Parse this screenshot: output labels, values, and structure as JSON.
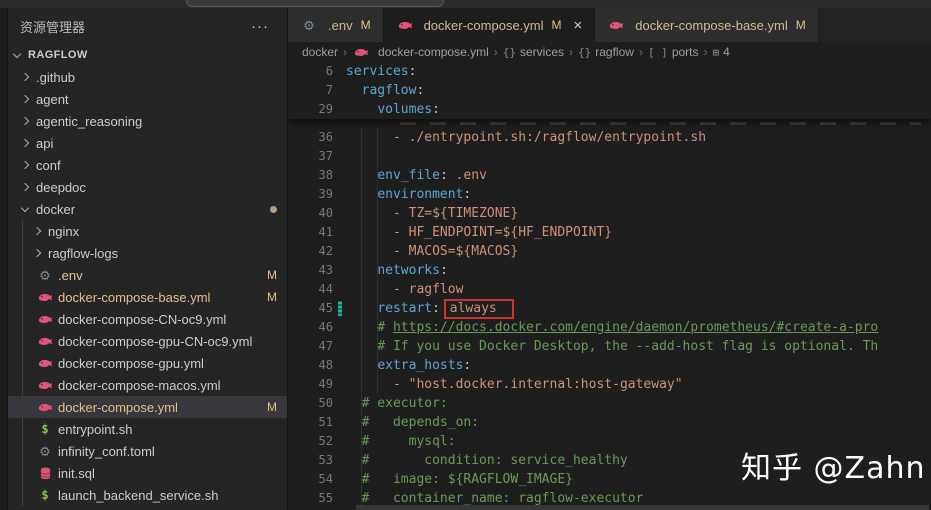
{
  "titlebar": {
    "command_center": ""
  },
  "sidebar": {
    "header": "资源管理器",
    "more": "···",
    "section": "RAGFLOW",
    "items": [
      {
        "label": ".github",
        "kind": "folder",
        "depth": 1
      },
      {
        "label": "agent",
        "kind": "folder",
        "depth": 1
      },
      {
        "label": "agentic_reasoning",
        "kind": "folder",
        "depth": 1
      },
      {
        "label": "api",
        "kind": "folder",
        "depth": 1
      },
      {
        "label": "conf",
        "kind": "folder",
        "depth": 1
      },
      {
        "label": "deepdoc",
        "kind": "folder",
        "depth": 1
      },
      {
        "label": "docker",
        "kind": "folder",
        "depth": 1,
        "expanded": true,
        "dot": true
      },
      {
        "label": "nginx",
        "kind": "folder",
        "depth": 2
      },
      {
        "label": "ragflow-logs",
        "kind": "folder",
        "depth": 2
      },
      {
        "label": ".env",
        "kind": "file",
        "icon": "gear",
        "depth": 2,
        "badge": "M",
        "modified": true
      },
      {
        "label": "docker-compose-base.yml",
        "kind": "file",
        "icon": "docker",
        "depth": 2,
        "badge": "M",
        "modified": true
      },
      {
        "label": "docker-compose-CN-oc9.yml",
        "kind": "file",
        "icon": "docker",
        "depth": 2
      },
      {
        "label": "docker-compose-gpu-CN-oc9.yml",
        "kind": "file",
        "icon": "docker",
        "depth": 2
      },
      {
        "label": "docker-compose-gpu.yml",
        "kind": "file",
        "icon": "docker",
        "depth": 2
      },
      {
        "label": "docker-compose-macos.yml",
        "kind": "file",
        "icon": "docker",
        "depth": 2
      },
      {
        "label": "docker-compose.yml",
        "kind": "file",
        "icon": "docker",
        "depth": 2,
        "badge": "M",
        "modified": true,
        "selected": true
      },
      {
        "label": "entrypoint.sh",
        "kind": "file",
        "icon": "shell",
        "depth": 2
      },
      {
        "label": "infinity_conf.toml",
        "kind": "file",
        "icon": "gear",
        "depth": 2
      },
      {
        "label": "init.sql",
        "kind": "file",
        "icon": "database",
        "depth": 2
      },
      {
        "label": "launch_backend_service.sh",
        "kind": "file",
        "icon": "shell",
        "depth": 2
      }
    ]
  },
  "tabs": [
    {
      "label": ".env",
      "icon": "gear",
      "badge": "M",
      "active": false
    },
    {
      "label": "docker-compose.yml",
      "icon": "docker",
      "badge": "M",
      "active": true,
      "close": "×"
    },
    {
      "label": "docker-compose-base.yml",
      "icon": "docker",
      "badge": "M",
      "active": false
    }
  ],
  "breadcrumb": [
    {
      "label": "docker"
    },
    {
      "label": "docker-compose.yml",
      "icon": "docker"
    },
    {
      "label": "services",
      "icon": "object"
    },
    {
      "label": "ragflow",
      "icon": "object"
    },
    {
      "label": "ports",
      "icon": "array"
    },
    {
      "label": "4",
      "icon": "value"
    }
  ],
  "editor": {
    "watermark": "知乎 @Zahn",
    "sticky_lines": [
      {
        "num": "6",
        "tokens": [
          {
            "t": "services",
            "c": "key"
          },
          {
            "t": ":",
            "c": "punc"
          }
        ]
      },
      {
        "num": "7",
        "tokens": [
          {
            "t": "  "
          },
          {
            "t": "ragflow",
            "c": "key"
          },
          {
            "t": ":",
            "c": "punc"
          }
        ]
      },
      {
        "num": "29",
        "tokens": [
          {
            "t": "    "
          },
          {
            "t": "volumes",
            "c": "key"
          },
          {
            "t": ":",
            "c": "punc"
          }
        ]
      }
    ],
    "lines": [
      {
        "num": "36",
        "tokens": [
          {
            "t": "      "
          },
          {
            "t": "- ",
            "c": "dash"
          },
          {
            "t": "./entrypoint.sh:/ragflow/entrypoint.sh",
            "c": "val"
          }
        ]
      },
      {
        "num": "37",
        "tokens": []
      },
      {
        "num": "38",
        "tokens": [
          {
            "t": "    "
          },
          {
            "t": "env_file",
            "c": "key"
          },
          {
            "t": ": ",
            "c": "punc"
          },
          {
            "t": ".env",
            "c": "val"
          }
        ]
      },
      {
        "num": "39",
        "tokens": [
          {
            "t": "    "
          },
          {
            "t": "environment",
            "c": "key"
          },
          {
            "t": ":",
            "c": "punc"
          }
        ]
      },
      {
        "num": "40",
        "tokens": [
          {
            "t": "      "
          },
          {
            "t": "- ",
            "c": "dash"
          },
          {
            "t": "TZ=${TIMEZONE}",
            "c": "val"
          }
        ]
      },
      {
        "num": "41",
        "tokens": [
          {
            "t": "      "
          },
          {
            "t": "- ",
            "c": "dash"
          },
          {
            "t": "HF_ENDPOINT=${HF_ENDPOINT}",
            "c": "val"
          }
        ]
      },
      {
        "num": "42",
        "tokens": [
          {
            "t": "      "
          },
          {
            "t": "- ",
            "c": "dash"
          },
          {
            "t": "MACOS=${MACOS}",
            "c": "val"
          }
        ]
      },
      {
        "num": "43",
        "tokens": [
          {
            "t": "    "
          },
          {
            "t": "networks",
            "c": "key"
          },
          {
            "t": ":",
            "c": "punc"
          }
        ]
      },
      {
        "num": "44",
        "tokens": [
          {
            "t": "      "
          },
          {
            "t": "- ",
            "c": "dash"
          },
          {
            "t": "ragflow",
            "c": "val"
          }
        ]
      },
      {
        "num": "45",
        "marker": true,
        "tokens": [
          {
            "t": "    "
          },
          {
            "t": "restart",
            "c": "key"
          },
          {
            "t": ": ",
            "c": "punc"
          },
          {
            "t": "always",
            "c": "val boxed"
          }
        ]
      },
      {
        "num": "46",
        "tokens": [
          {
            "t": "    "
          },
          {
            "t": "# ",
            "c": "comment"
          },
          {
            "t": "https://docs.docker.com/engine/daemon/prometheus/#create-a-pro",
            "c": "url"
          }
        ]
      },
      {
        "num": "47",
        "tokens": [
          {
            "t": "    "
          },
          {
            "t": "# If you use Docker Desktop, the --add-host flag is optional. Th",
            "c": "comment"
          }
        ]
      },
      {
        "num": "48",
        "tokens": [
          {
            "t": "    "
          },
          {
            "t": "extra_hosts",
            "c": "key"
          },
          {
            "t": ":",
            "c": "punc"
          }
        ]
      },
      {
        "num": "49",
        "tokens": [
          {
            "t": "      "
          },
          {
            "t": "- ",
            "c": "dash"
          },
          {
            "t": "\"host.docker.internal:host-gateway\"",
            "c": "val"
          }
        ]
      },
      {
        "num": "50",
        "tokens": [
          {
            "t": "  "
          },
          {
            "t": "# executor:",
            "c": "comment"
          }
        ]
      },
      {
        "num": "51",
        "tokens": [
          {
            "t": "  "
          },
          {
            "t": "#   depends_on:",
            "c": "comment"
          }
        ]
      },
      {
        "num": "52",
        "tokens": [
          {
            "t": "  "
          },
          {
            "t": "#     mysql:",
            "c": "comment"
          }
        ]
      },
      {
        "num": "53",
        "tokens": [
          {
            "t": "  "
          },
          {
            "t": "#       condition: service_healthy",
            "c": "comment"
          }
        ]
      },
      {
        "num": "54",
        "tokens": [
          {
            "t": "  "
          },
          {
            "t": "#   image: ${RAGFLOW_IMAGE}",
            "c": "comment"
          }
        ]
      },
      {
        "num": "55",
        "tokens": [
          {
            "t": "  "
          },
          {
            "t": "#   container_name: ragflow-executor",
            "c": "comment"
          }
        ]
      }
    ]
  },
  "colors": {
    "modified": "#e2c08d",
    "docker_icon": "#e2537a",
    "shell_icon": "#8dc149",
    "gear_icon": "#7d8b99",
    "annotation_red": "#d03232",
    "yaml_key": "#58a6d2",
    "yaml_value": "#ce9178",
    "comment_green": "#6a9955",
    "gutter_modified_teal": "#19b9a8"
  }
}
